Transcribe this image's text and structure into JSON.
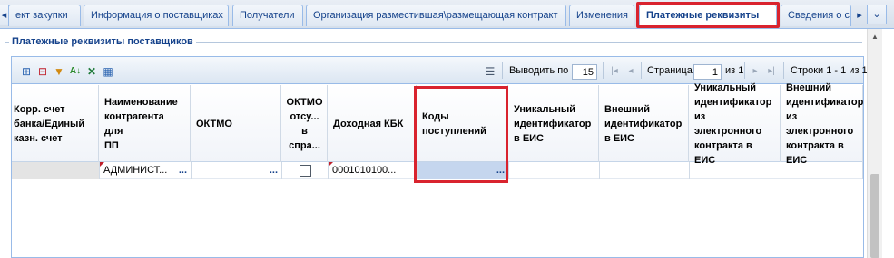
{
  "tabs": [
    {
      "label": "ект закупки"
    },
    {
      "label": "Информация о поставщиках"
    },
    {
      "label": "Получатели"
    },
    {
      "label": "Организация разместившая\\размещающая контракт"
    },
    {
      "label": "Изменения"
    },
    {
      "label": "Платежные реквизиты"
    },
    {
      "label": "Сведения о со"
    }
  ],
  "active_tab": "Платежные реквизиты",
  "section_title": "Платежные реквизиты поставщиков",
  "toolbar": {
    "page_size_label": "Выводить по",
    "page_size_value": "15",
    "page_label": "Страница",
    "page_value": "1",
    "page_of": "из 1",
    "rows_info": "Строки 1 - 1 из 1"
  },
  "columns": [
    {
      "lines": [
        "Корр. счет",
        "банка/Единый",
        "казн. счет"
      ]
    },
    {
      "lines": [
        "Наименование",
        "контрагента для",
        "ПП"
      ]
    },
    {
      "lines": [
        "ОКТМО"
      ]
    },
    {
      "lines": [
        "ОКТМО",
        "отсу...",
        "в",
        "спра..."
      ]
    },
    {
      "lines": [
        "Доходная КБК"
      ]
    },
    {
      "lines": [
        "Коды",
        "поступлений"
      ]
    },
    {
      "lines": [
        "Уникальный",
        "идентификатор",
        "в ЕИС"
      ]
    },
    {
      "lines": [
        "Внешний",
        "идентификатор",
        "в ЕИС"
      ]
    },
    {
      "lines": [
        "Уникальный",
        "идентификатор",
        "из электронного",
        "контракта в",
        "ЕИС"
      ]
    },
    {
      "lines": [
        "Внешний",
        "идентификатор",
        "из электронного",
        "контракта в",
        "ЕИС"
      ]
    }
  ],
  "row": {
    "counterparty": "АДМИНИСТ...",
    "counterparty_more": "...",
    "oktmo_more": "...",
    "kbk": "0001010100...",
    "codes_more": "..."
  },
  "colors": {
    "accent": "#15428b",
    "highlight": "#d9232e",
    "selected_cell": "#c5d6ee"
  }
}
